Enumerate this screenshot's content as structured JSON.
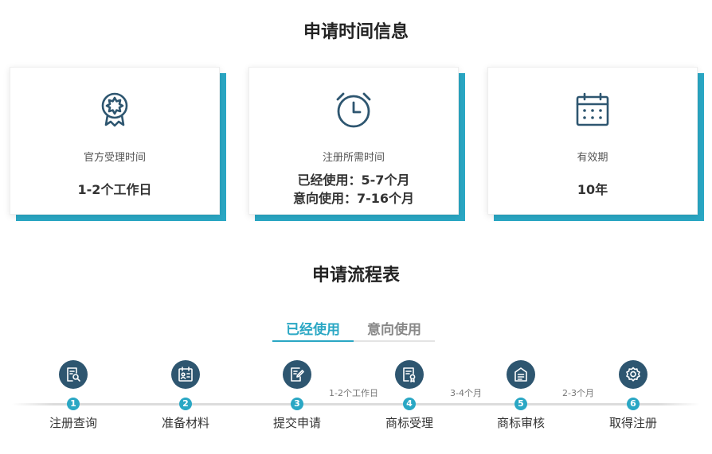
{
  "info_section": {
    "title": "申请时间信息",
    "cards": [
      {
        "icon": "award-badge-icon",
        "label": "官方受理时间",
        "value_lines": [
          "1-2个工作日"
        ]
      },
      {
        "icon": "alarm-clock-icon",
        "label": "注册所需时间",
        "value_lines": [
          "已经使用：5-7个月",
          "意向使用：7-16个月"
        ]
      },
      {
        "icon": "calendar-icon",
        "label": "有效期",
        "value_lines": [
          "10年"
        ]
      }
    ]
  },
  "process_section": {
    "title": "申请流程表",
    "tabs": [
      {
        "label": "已经使用",
        "active": true
      },
      {
        "label": "意向使用",
        "active": false
      }
    ],
    "steps": [
      {
        "number": "1",
        "label": "注册查询",
        "icon": "search-document-icon"
      },
      {
        "number": "2",
        "label": "准备材料",
        "icon": "id-card-icon"
      },
      {
        "number": "3",
        "label": "提交申请",
        "icon": "edit-document-icon"
      },
      {
        "number": "4",
        "label": "商标受理",
        "icon": "certificate-icon"
      },
      {
        "number": "5",
        "label": "商标审核",
        "icon": "review-icon"
      },
      {
        "number": "6",
        "label": "取得注册",
        "icon": "seal-icon"
      }
    ],
    "durations": [
      "1-2个工作日",
      "3-4个月",
      "2-3个月"
    ]
  },
  "colors": {
    "accent": "#2aa7c4",
    "icon_dark": "#2e5670",
    "text": "#333333"
  }
}
